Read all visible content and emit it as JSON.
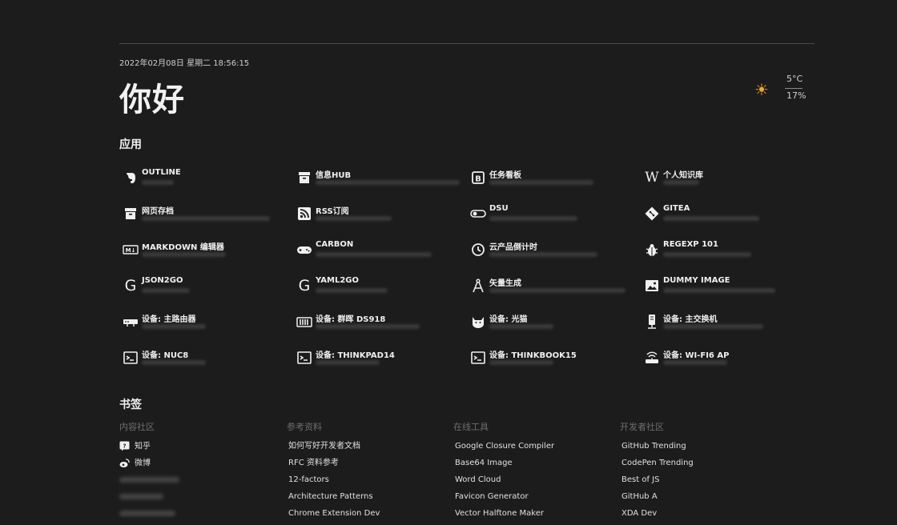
{
  "header": {
    "datetime": "2022年02月08日 星期二 18:56:15",
    "greeting": "你好"
  },
  "weather": {
    "icon": "sun-icon",
    "temperature": "5°C",
    "humidity": "17%",
    "icon_color": "#f5a623"
  },
  "apps_section": {
    "title": "应用",
    "items": [
      {
        "label": "OUTLINE",
        "icon": "evernote-icon"
      },
      {
        "label": "信息HUB",
        "icon": "archive-box-icon"
      },
      {
        "label": "任务看板",
        "icon": "board-b-icon"
      },
      {
        "label": "个人知识库",
        "icon": "wikipedia-icon"
      },
      {
        "label": "网页存档",
        "icon": "archive-box-icon"
      },
      {
        "label": "RSS订阅",
        "icon": "rss-icon"
      },
      {
        "label": "DSU",
        "icon": "toggle-icon"
      },
      {
        "label": "GITEA",
        "icon": "git-icon"
      },
      {
        "label": "MARKDOWN 编辑器",
        "icon": "markdown-icon"
      },
      {
        "label": "CARBON",
        "icon": "gamepad-icon"
      },
      {
        "label": "云产品倒计时",
        "icon": "clock-icon"
      },
      {
        "label": "REGEXP 101",
        "icon": "bug-icon"
      },
      {
        "label": "JSON2GO",
        "icon": "google-g-icon"
      },
      {
        "label": "YAML2GO",
        "icon": "google-g-icon"
      },
      {
        "label": "矢量生成",
        "icon": "compass-icon"
      },
      {
        "label": "DUMMY IMAGE",
        "icon": "image-icon"
      },
      {
        "label": "设备: 主路由器",
        "icon": "router-icon"
      },
      {
        "label": "设备: 群晖 DS918",
        "icon": "nas-icon"
      },
      {
        "label": "设备: 光猫",
        "icon": "cat-icon"
      },
      {
        "label": "设备: 主交换机",
        "icon": "switch-icon"
      },
      {
        "label": "设备: NUC8",
        "icon": "terminal-icon"
      },
      {
        "label": "设备: THINKPAD14",
        "icon": "terminal-icon"
      },
      {
        "label": "设备: THINKBOOK15",
        "icon": "terminal-icon"
      },
      {
        "label": "设备: WI-FI6 AP",
        "icon": "wifi-router-icon"
      }
    ]
  },
  "bookmarks_section": {
    "title": "书签",
    "columns": [
      {
        "heading": "内容社区",
        "items": [
          {
            "label": "知乎",
            "icon": "zhihu-icon"
          },
          {
            "label": "微博",
            "icon": "weibo-icon"
          }
        ]
      },
      {
        "heading": "参考资料",
        "items": [
          {
            "label": "如何写好开发者文档"
          },
          {
            "label": "RFC 资料参考"
          },
          {
            "label": "12-factors"
          },
          {
            "label": "Architecture Patterns"
          },
          {
            "label": "Chrome Extension Dev"
          }
        ]
      },
      {
        "heading": "在线工具",
        "items": [
          {
            "label": "Google Closure Compiler"
          },
          {
            "label": "Base64 Image"
          },
          {
            "label": "Word Cloud"
          },
          {
            "label": "Favicon Generator"
          },
          {
            "label": "Vector Halftone Maker"
          }
        ]
      },
      {
        "heading": "开发者社区",
        "items": [
          {
            "label": "GitHub Trending"
          },
          {
            "label": "CodePen Trending"
          },
          {
            "label": "Best of JS"
          },
          {
            "label": "GitHub A"
          },
          {
            "label": "XDA Dev"
          }
        ]
      }
    ]
  }
}
